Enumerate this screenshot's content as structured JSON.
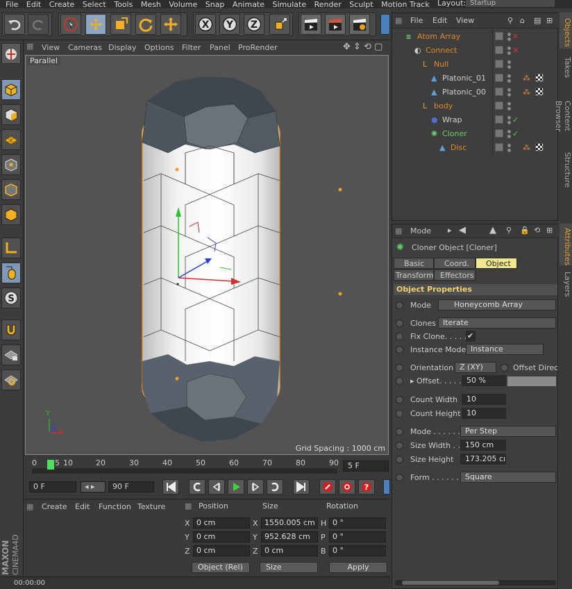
{
  "menubar": {
    "items": [
      "File",
      "Edit",
      "Create",
      "Select",
      "Tools",
      "Mesh",
      "Volume",
      "Snap",
      "Animate",
      "Simulate",
      "Render",
      "Sculpt",
      "Motion Track"
    ],
    "layout_label": "Layout:",
    "layout_value": "Startup"
  },
  "viewport": {
    "menu": [
      "View",
      "Cameras",
      "Display",
      "Options",
      "Filter",
      "Panel",
      "ProRender"
    ],
    "projection": "Parallel",
    "grid_spacing": "Grid Spacing : 1000 cm",
    "axis_y": "Y",
    "axis_z": "Z",
    "axis_x": "X"
  },
  "timeline": {
    "ticks": [
      "0",
      "5",
      "10",
      "20",
      "30",
      "40",
      "50",
      "60",
      "70",
      "80",
      "90"
    ],
    "current_frame": "5 F"
  },
  "transport": {
    "start_field": "0 F",
    "end_field": "90 F"
  },
  "material": {
    "menu": [
      "Create",
      "Edit",
      "Function",
      "Texture"
    ]
  },
  "coords": {
    "headers": {
      "position": "Position",
      "size": "Size",
      "rotation": "Rotation"
    },
    "rows": [
      {
        "axis": "X",
        "pos": "0 cm",
        "size_axis": "X",
        "size": "1550.005 cm",
        "rot_axis": "H",
        "rot": "0 °"
      },
      {
        "axis": "Y",
        "pos": "0 cm",
        "size_axis": "Y",
        "size": "952.628 cm",
        "rot_axis": "P",
        "rot": "0 °"
      },
      {
        "axis": "Z",
        "pos": "0 cm",
        "size_axis": "Z",
        "size": "0 cm",
        "rot_axis": "B",
        "rot": "0 °"
      }
    ],
    "mode_button": "Object (Rel)",
    "size_button": "Size",
    "apply_button": "Apply"
  },
  "status": {
    "time": "00:00:00"
  },
  "maxon": {
    "brand": "MAXON",
    "product": "CINEMA4D"
  },
  "objects_panel": {
    "menu": [
      "File",
      "Edit",
      "View"
    ],
    "tree": [
      {
        "name": "Atom Array",
        "color": "#e08a2a",
        "indent": 0
      },
      {
        "name": "Connect",
        "color": "#e08a2a",
        "indent": 1
      },
      {
        "name": "Null",
        "color": "#e08a2a",
        "indent": 2
      },
      {
        "name": "Platonic_01",
        "color": "#cfcfcf",
        "indent": 3
      },
      {
        "name": "Platonic_00",
        "color": "#cfcfcf",
        "indent": 3
      },
      {
        "name": "body",
        "color": "#e08a2a",
        "indent": 2
      },
      {
        "name": "Wrap",
        "color": "#cfcfcf",
        "indent": 3
      },
      {
        "name": "Cloner",
        "color": "#66d066",
        "indent": 3
      },
      {
        "name": "Disc",
        "color": "#e08a2a",
        "indent": 4
      }
    ]
  },
  "side_tabs_top": [
    "Objects",
    "Takes",
    "Content Browser",
    "Structure"
  ],
  "side_tabs_bottom": [
    "Attributes",
    "Layers"
  ],
  "attributes": {
    "mode_label": "Mode",
    "object_title": "Cloner Object [Cloner]",
    "tabs": [
      "Basic",
      "Coord.",
      "Object",
      "Transform",
      "Effectors"
    ],
    "selected_tab": "Object",
    "section": "Object Properties",
    "rows": {
      "mode": {
        "label": "Mode",
        "value": "Honeycomb Array"
      },
      "clones": {
        "label": "Clones",
        "value": "Iterate"
      },
      "fix_clone": {
        "label": "Fix Clone. . . . .",
        "value": "✔"
      },
      "instance_mode": {
        "label": "Instance Mode",
        "value": "Instance"
      },
      "orientation": {
        "label": "Orientation",
        "value": "Z (XY)",
        "extra": "Offset Direc"
      },
      "offset": {
        "label": "▸ Offset. . . . .",
        "value": "50 %"
      },
      "count_width": {
        "label": "Count Width",
        "value": "10"
      },
      "count_height": {
        "label": "Count Height",
        "value": "10"
      },
      "mode2": {
        "label": "Mode . . . . . .",
        "value": "Per Step"
      },
      "size_width": {
        "label": "Size Width . .",
        "value": "150 cm"
      },
      "size_height": {
        "label": "Size Height",
        "value": "173.205 cı"
      },
      "form": {
        "label": "Form . . . . . . .",
        "value": "Square"
      }
    }
  }
}
